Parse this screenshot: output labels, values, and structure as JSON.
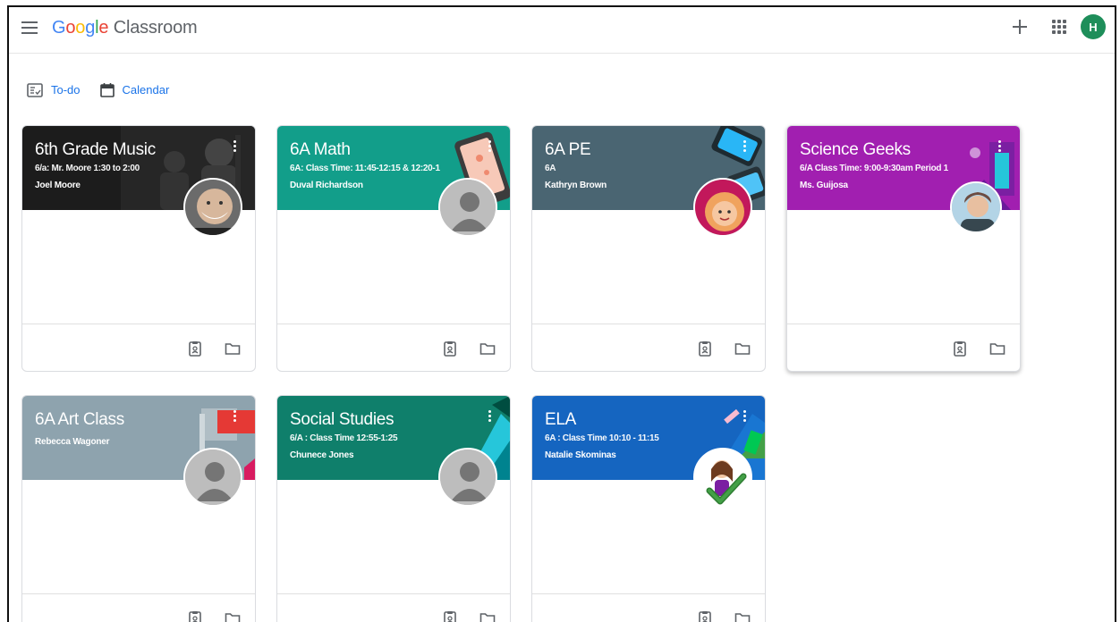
{
  "app": {
    "logo_letters": [
      "G",
      "o",
      "o",
      "g",
      "l",
      "e"
    ],
    "logo_rest": " Classroom",
    "user_initial": "H"
  },
  "icons": {
    "menu": "hamburger-menu-icon",
    "add": "plus-icon",
    "apps": "grid-apps-icon",
    "todo": "todo-list-icon",
    "calendar": "calendar-icon",
    "assignments": "assignment-clipboard-icon",
    "folder": "folder-icon",
    "more": "more-vert-icon"
  },
  "nav": {
    "todo_label": "To-do",
    "calendar_label": "Calendar"
  },
  "colors": {
    "accent": "#1a73e8",
    "user_avatar": "#1e8e5a"
  },
  "classes": [
    {
      "title": "6th Grade Music",
      "section": "6/a: Mr. Moore 1:30 to 2:00",
      "teacher": "Joel Moore",
      "color": "#1c1c1c"
    },
    {
      "title": "6A Math",
      "section": "6A: Class Time: 11:45-12:15 & 12:20-1",
      "teacher": "Duval Richardson",
      "color": "#129e8a"
    },
    {
      "title": "6A PE",
      "section": "6A",
      "teacher": "Kathryn Brown",
      "color": "#4a6572"
    },
    {
      "title": "Science Geeks",
      "section": "6/A Class Time: 9:00-9:30am Period 1",
      "teacher": "Ms. Guijosa",
      "color": "#a11fb0"
    },
    {
      "title": "6A Art Class",
      "section": "",
      "teacher": "Rebecca Wagoner",
      "color": "#8ea3ae"
    },
    {
      "title": "Social Studies",
      "section": "6/A : Class Time 12:55-1:25",
      "teacher": "Chunece Jones",
      "color": "#0f7f6b"
    },
    {
      "title": "ELA",
      "section": "6A : Class Time 10:10 - 11:15",
      "teacher": "Natalie Skominas",
      "color": "#1565c0"
    }
  ]
}
